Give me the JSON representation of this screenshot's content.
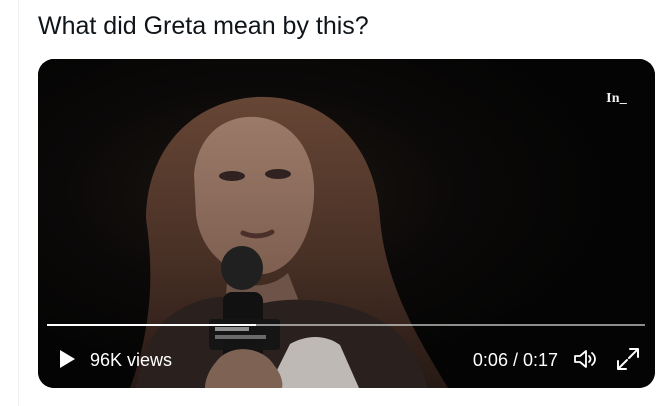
{
  "tweet": {
    "text": "What did Greta mean by this?"
  },
  "video": {
    "watermark": "In_",
    "views": "96K views",
    "time": "0:06 / 0:17",
    "progress": 0.35,
    "icons": {
      "play": "play-icon",
      "volume": "volume-icon",
      "fullscreen": "fullscreen-icon"
    }
  },
  "colors": {
    "text": "#0f1419",
    "video_bg": "#060505",
    "controls": "#ffffff"
  }
}
